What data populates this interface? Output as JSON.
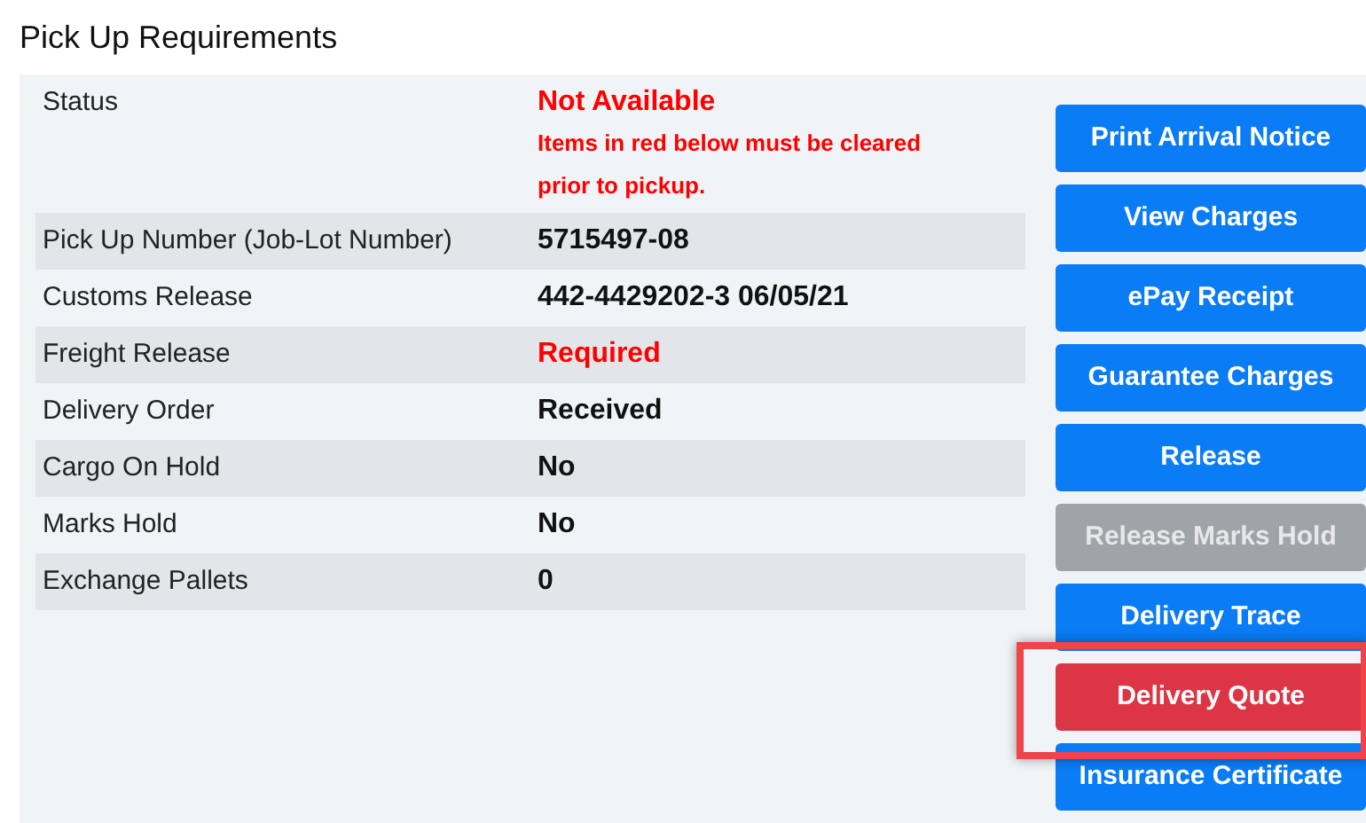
{
  "title": "Pick Up Requirements",
  "status": {
    "label": "Status",
    "value": "Not Available",
    "note": "Items in red below must be cleared prior to pickup."
  },
  "rows": [
    {
      "label": "Pick Up Number (Job-Lot Number)",
      "value": "5715497-08",
      "alert": false
    },
    {
      "label": "Customs Release",
      "value": "442-4429202-3 06/05/21",
      "alert": false
    },
    {
      "label": "Freight Release",
      "value": "Required",
      "alert": true
    },
    {
      "label": "Delivery Order",
      "value": "Received",
      "alert": false
    },
    {
      "label": "Cargo On Hold",
      "value": "No",
      "alert": false
    },
    {
      "label": "Marks Hold",
      "value": "No",
      "alert": false
    },
    {
      "label": "Exchange Pallets",
      "value": "0",
      "alert": false
    }
  ],
  "buttons": [
    {
      "label": "Print Arrival Notice",
      "kind": "primary",
      "highlighted": false
    },
    {
      "label": "View Charges",
      "kind": "primary",
      "highlighted": false
    },
    {
      "label": "ePay Receipt",
      "kind": "primary",
      "highlighted": false
    },
    {
      "label": "Guarantee Charges",
      "kind": "primary",
      "highlighted": false
    },
    {
      "label": "Release",
      "kind": "primary",
      "highlighted": false
    },
    {
      "label": "Release Marks Hold",
      "kind": "disabled",
      "highlighted": false
    },
    {
      "label": "Delivery Trace",
      "kind": "primary",
      "highlighted": false
    },
    {
      "label": "Delivery Quote",
      "kind": "danger",
      "highlighted": true
    },
    {
      "label": "Insurance Certificate",
      "kind": "primary",
      "highlighted": false
    }
  ]
}
